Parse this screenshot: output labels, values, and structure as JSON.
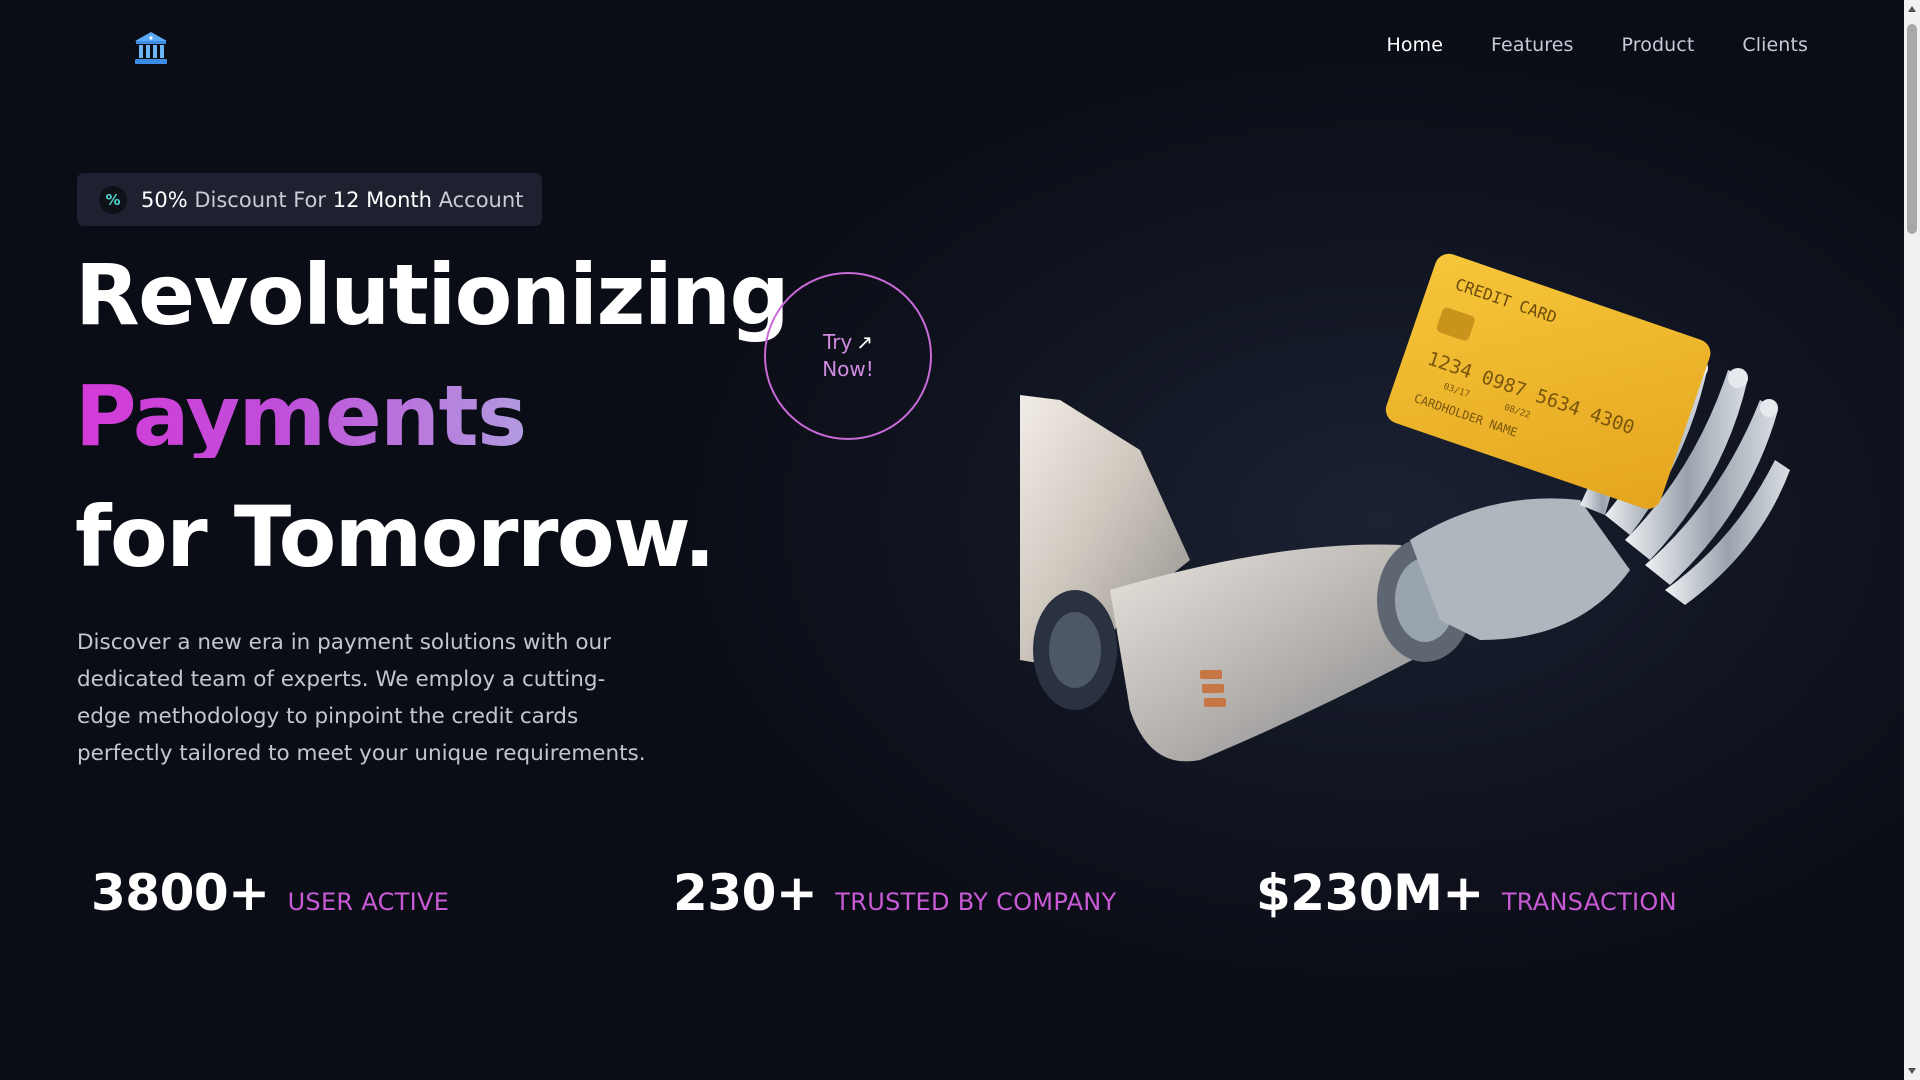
{
  "nav": {
    "items": [
      {
        "label": "Home",
        "active": true
      },
      {
        "label": "Features",
        "active": false
      },
      {
        "label": "Product",
        "active": false
      },
      {
        "label": "Clients",
        "active": false
      }
    ]
  },
  "logo": {
    "icon": "bank-icon",
    "color": "#5aa9f5"
  },
  "badge": {
    "icon": "percent-icon",
    "highlight_1": "50%",
    "text_1": " Discount For ",
    "highlight_2": "12 Month",
    "text_2": " Account"
  },
  "hero": {
    "line1": "Revolutionizing",
    "line2": "Payments",
    "line3": "for Tomorrow.",
    "cta_line1": "Try",
    "cta_arrow": "↗",
    "cta_line2": "Now!",
    "description": "Discover a new era in payment solutions with our dedicated team of experts. We employ a cutting-edge methodology to pinpoint the credit cards perfectly tailored to meet your unique requirements."
  },
  "illustration": {
    "card_title": "CREDIT CARD",
    "card_number": "1234 0987 5634 4300",
    "card_holder": "CARDHOLDER NAME",
    "valid_from": "03/17",
    "valid_to": "08/22",
    "card_color": "#f2b92c"
  },
  "stats": [
    {
      "value": "3800+",
      "label": "USER ACTIVE"
    },
    {
      "value": "230+",
      "label": "TRUSTED BY COMPANY"
    },
    {
      "value": "$230M+",
      "label": "TRANSACTION"
    }
  ],
  "colors": {
    "accent": "#c85ad6",
    "background": "#0b0d16"
  }
}
